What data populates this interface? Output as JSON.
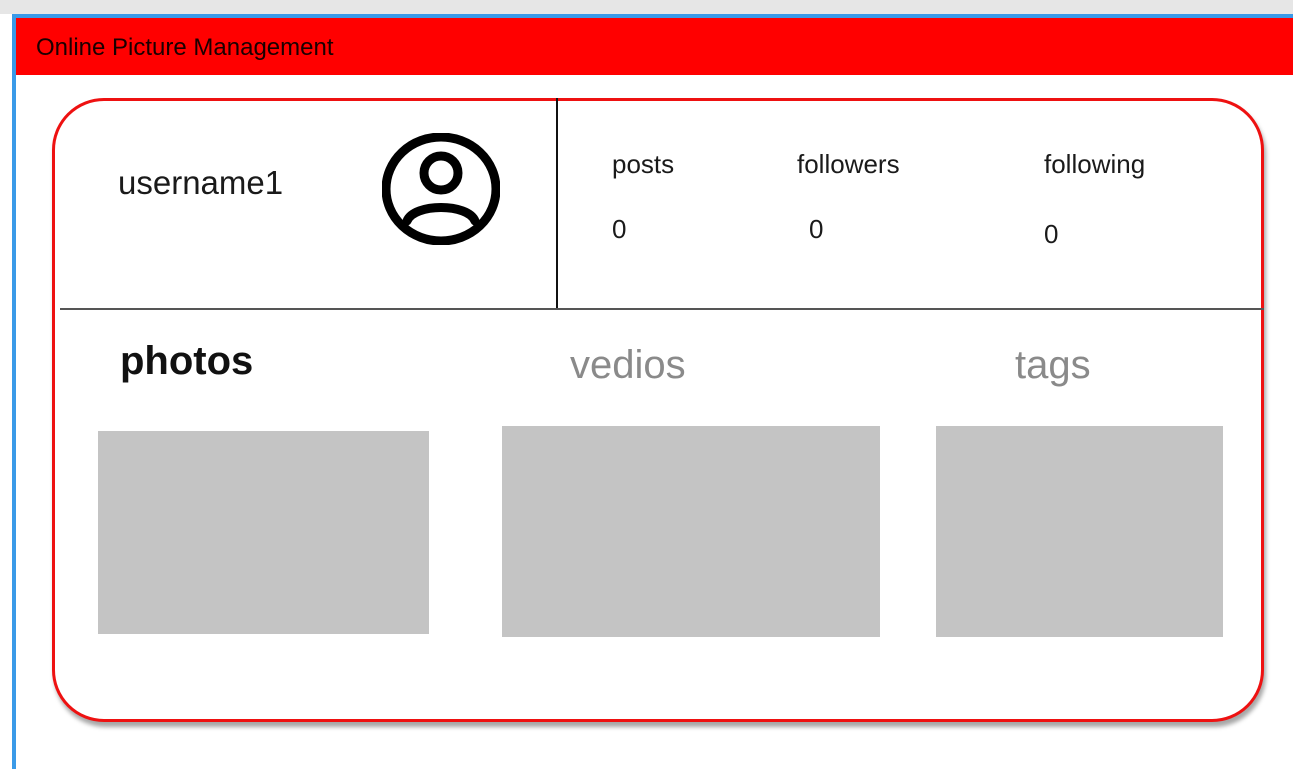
{
  "app": {
    "title": "Online Picture Management"
  },
  "colors": {
    "header_bg": "#ff0000",
    "card_border": "#ee1111",
    "window_accent": "#3a9ae8",
    "placeholder": "#c4c4c4",
    "tab_inactive": "#8a8a8a"
  },
  "profile": {
    "username": "username1",
    "avatar_icon": "user-circle-icon",
    "stats": [
      {
        "label": "posts",
        "value": "0"
      },
      {
        "label": "followers",
        "value": "0"
      },
      {
        "label": "following",
        "value": "0"
      }
    ]
  },
  "tabs": [
    {
      "label": "photos",
      "active": true
    },
    {
      "label": "vedios",
      "active": false
    },
    {
      "label": "tags",
      "active": false
    }
  ]
}
